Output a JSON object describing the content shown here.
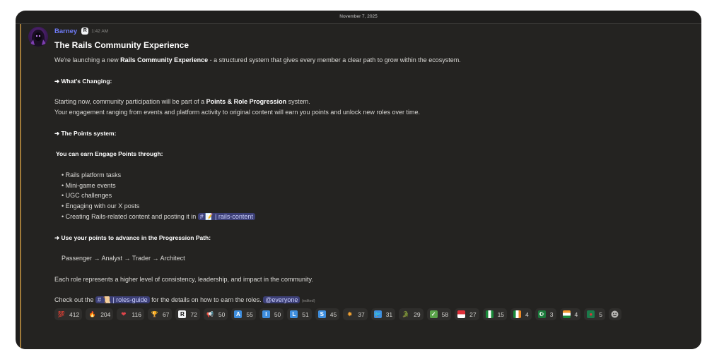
{
  "date_divider": "November 7, 2025",
  "message": {
    "author": "Barney",
    "bot_tag": "R",
    "time": "1:42 AM",
    "title": "The Rails Community Experience",
    "intro_pre": "We're launching a new ",
    "intro_bold": "Rails Community Experience",
    "intro_post": " - a structured system that gives every member a clear path to grow within the ecosystem.",
    "changing_heading": "➜ What's Changing:",
    "changing_pre": "Starting now, community participation will be part of a ",
    "changing_bold": "Points & Role Progression",
    "changing_post": " system.",
    "engagement_line": "Your engagement ranging from events and platform activity to original content  will earn you points and unlock new roles over time.",
    "points_heading": "➜ The Points system:",
    "earn_heading": "You can earn Engage Points through:",
    "bullets": [
      "• Rails platform tasks",
      "• Mini-game events",
      "• UGC challenges",
      "• Engaging with our X posts"
    ],
    "last_bullet_pre": "• Creating Rails-related content and posting it in ",
    "channel_content": "# 📝 | rails-content",
    "advance_heading": "➜ Use your points to advance in the Progression Path:",
    "progression": "Passenger → Analyst → Trader → Architect",
    "role_line": "Each role represents a higher level of consistency, leadership, and impact in the community.",
    "checkout_pre": "Check out the ",
    "channel_guide": "# 📜 | roles-guide",
    "checkout_post": " for the details on how to earn the roles. ",
    "everyone": "@everyone",
    "edited": "(edited)"
  },
  "reactions": [
    {
      "emoji": "💯",
      "count": "412",
      "color": "#e0454b",
      "bg": "transparent",
      "fg": "#e0454b"
    },
    {
      "emoji": "🔥",
      "count": "204",
      "bg": "transparent",
      "fg": "#f39c12"
    },
    {
      "emoji": "❤",
      "count": "116",
      "bg": "transparent",
      "fg": "#e0454b"
    },
    {
      "emoji": "🏆",
      "count": "67",
      "bg": "transparent",
      "fg": "#4a8fd8"
    },
    {
      "emoji": "R",
      "count": "72",
      "bg": "#f2f3f5",
      "fg": "#111111"
    },
    {
      "emoji": "📢",
      "count": "50",
      "bg": "transparent",
      "fg": "#e0454b"
    },
    {
      "emoji": "A",
      "count": "55",
      "bg": "#3e8ede",
      "fg": "#ffffff"
    },
    {
      "emoji": "I",
      "count": "50",
      "bg": "#3e8ede",
      "fg": "#ffffff"
    },
    {
      "emoji": "L",
      "count": "51",
      "bg": "#3e8ede",
      "fg": "#ffffff"
    },
    {
      "emoji": "S",
      "count": "45",
      "bg": "#3e8ede",
      "fg": "#ffffff"
    },
    {
      "emoji": "✸",
      "count": "37",
      "bg": "transparent",
      "fg": "#f0a030"
    },
    {
      "emoji": "🐦",
      "count": "31",
      "bg": "#3e8ede",
      "fg": "#ffffff"
    },
    {
      "emoji": "🐊",
      "count": "29",
      "bg": "transparent",
      "fg": "#5aa44a"
    },
    {
      "emoji": "✓",
      "count": "58",
      "bg": "#5aa44a",
      "fg": "#ffffff"
    },
    {
      "emoji": "",
      "count": "27",
      "bg": "linear-gradient(#e0303a 50%, #ffffff 50%)",
      "fg": "#ffffff"
    },
    {
      "emoji": "",
      "count": "15",
      "bg": "linear-gradient(90deg, #1a8a3a 33%, #ffffff 33%, #ffffff 66%, #1a8a3a 66%)",
      "fg": "#ffffff"
    },
    {
      "emoji": "",
      "count": "4",
      "bg": "linear-gradient(90deg, #1a8a3a 33%, #ffffff 33%, #ffffff 66%, #f08a24 66%)",
      "fg": "#ffffff"
    },
    {
      "emoji": "☪",
      "count": "3",
      "bg": "#1a7a3a",
      "fg": "#ffffff"
    },
    {
      "emoji": "",
      "count": "4",
      "bg": "linear-gradient(#f39a30 33%, #ffffff 33%, #ffffff 66%, #1a8a3a 66%)",
      "fg": "#ffffff"
    },
    {
      "emoji": "●",
      "count": "5",
      "bg": "#1a7a4a",
      "fg": "#e0303a"
    }
  ]
}
